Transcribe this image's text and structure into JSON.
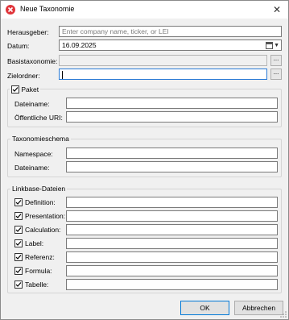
{
  "window": {
    "title": "Neue Taxonomie",
    "close_glyph": "✕"
  },
  "header": {
    "herausgeber_label": "Herausgeber:",
    "herausgeber_placeholder": "Enter company name, ticker, or LEI",
    "datum_label": "Datum:",
    "datum_value": "16.09.2025",
    "basis_label": "Basistaxonomie:",
    "basis_value": "",
    "ziel_label": "Zielordner:",
    "ziel_value": "",
    "browse_label": "..."
  },
  "paket": {
    "checkbox_label": "Paket",
    "checked": true,
    "dateiname_label": "Dateiname:",
    "dateiname_value": "",
    "uri_label": "Öffentliche URI:",
    "uri_value": ""
  },
  "schema": {
    "title": "Taxonomieschema",
    "namespace_label": "Namespace:",
    "namespace_value": "",
    "dateiname_label": "Dateiname:",
    "dateiname_value": ""
  },
  "linkbase": {
    "title": "Linkbase-Dateien",
    "items": [
      {
        "label": "Definition:",
        "checked": true,
        "value": ""
      },
      {
        "label": "Presentation:",
        "checked": true,
        "value": ""
      },
      {
        "label": "Calculation:",
        "checked": true,
        "value": ""
      },
      {
        "label": "Label:",
        "checked": true,
        "value": ""
      },
      {
        "label": "Referenz:",
        "checked": true,
        "value": ""
      },
      {
        "label": "Formula:",
        "checked": true,
        "value": ""
      },
      {
        "label": "Tabelle:",
        "checked": true,
        "value": ""
      }
    ]
  },
  "buttons": {
    "ok": "OK",
    "cancel": "Abbrechen"
  },
  "icons": {
    "app": "altova-app-icon",
    "calendar": "calendar-icon",
    "dropdown": "chevron-down-icon",
    "check": "checkmark-icon"
  },
  "colors": {
    "app_icon": "#e0343a",
    "focus_border": "#2a7ad6",
    "default_button_border": "#0078d7"
  }
}
